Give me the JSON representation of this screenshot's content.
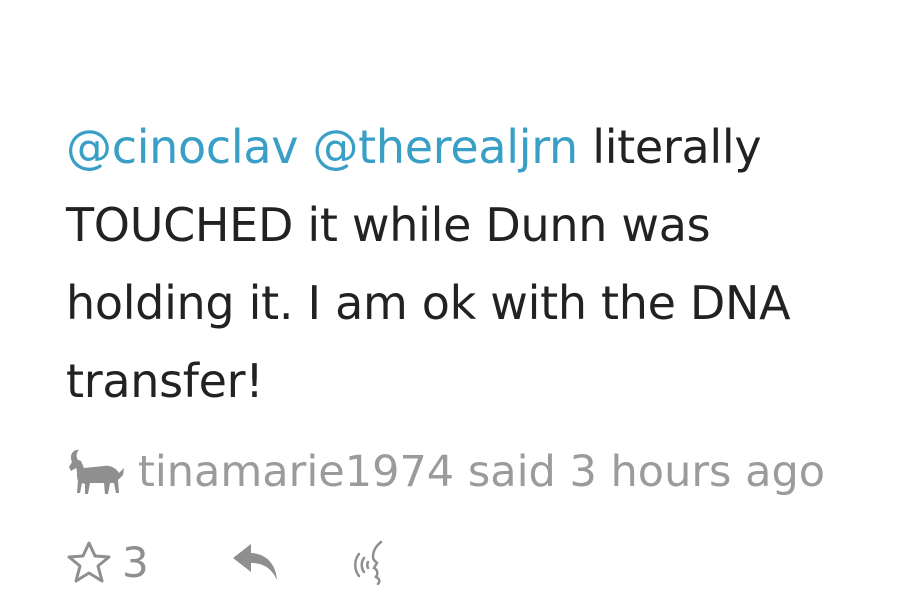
{
  "comment": {
    "mentions": [
      "@cinoclav",
      "@therealjrn"
    ],
    "text": "literally TOUCHED it while Dunn was holding it. I am ok with the DNA transfer!"
  },
  "meta": {
    "avatar_icon": "goat-icon",
    "username": "tinamarie1974",
    "said_text": "said",
    "time_ago": "3 hours ago"
  },
  "actions": {
    "like_icon": "star-outline-icon",
    "like_count": "3",
    "reply_icon": "reply-arrow-icon",
    "listen_icon": "speak-icon"
  },
  "colors": {
    "mention": "#3a9fc6",
    "body_text": "#222222",
    "meta_text": "#9b9b9b",
    "icon": "#8f8f8f"
  }
}
